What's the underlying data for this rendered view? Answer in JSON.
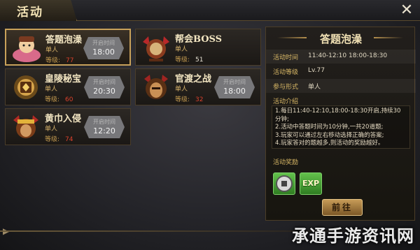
{
  "window": {
    "title": "活动",
    "close_glyph": "✕"
  },
  "activities": [
    {
      "name": "答题泡澡",
      "type": "单人",
      "level_label": "等级:",
      "level": "77",
      "time_label": "开启时间",
      "time": "18:00",
      "selected": true
    },
    {
      "name": "帮会BOSS",
      "type": "单人",
      "level_label": "等级:",
      "level": "51",
      "time_label": "",
      "time": "",
      "selected": false
    },
    {
      "name": "皇陵秘宝",
      "type": "单人",
      "level_label": "等级:",
      "level": "60",
      "time_label": "开启时间",
      "time": "20:30",
      "selected": false
    },
    {
      "name": "官渡之战",
      "type": "单人",
      "level_label": "等级:",
      "level": "32",
      "time_label": "开启时间",
      "time": "18:00",
      "selected": false
    },
    {
      "name": "黄巾入侵",
      "type": "单人",
      "level_label": "等级:",
      "level": "74",
      "time_label": "开启时间",
      "time": "12:20",
      "selected": false
    }
  ],
  "detail": {
    "title": "答题泡澡",
    "rows": [
      {
        "key": "活动时间",
        "value": "11:40-12:10 18:00-18:30"
      },
      {
        "key": "活动等级",
        "value": "Lv.77"
      },
      {
        "key": "参与形式",
        "value": "单人"
      }
    ],
    "intro_label": "活动介绍",
    "intro_lines": [
      "1.每日11:40-12:10,18:00-18:30开启,持续30",
      "分钟;",
      "2.活动中答题时间为10分钟,一共20道题;",
      "3.玩家可以通过左右移动选择正确的答案;",
      "4.玩家答对的题越多,则活动的奖励越好。"
    ],
    "reward_label": "活动奖励",
    "rewards": [
      {
        "icon": "silver-coin-icon",
        "text": ""
      },
      {
        "icon": "exp-icon",
        "text": "EXP"
      }
    ],
    "go_button": "前往"
  },
  "watermark": "承通手游资讯网",
  "colors": {
    "accent": "#c8a15a",
    "level_red": "#d9412c",
    "reward_green": "#4fae3a"
  }
}
